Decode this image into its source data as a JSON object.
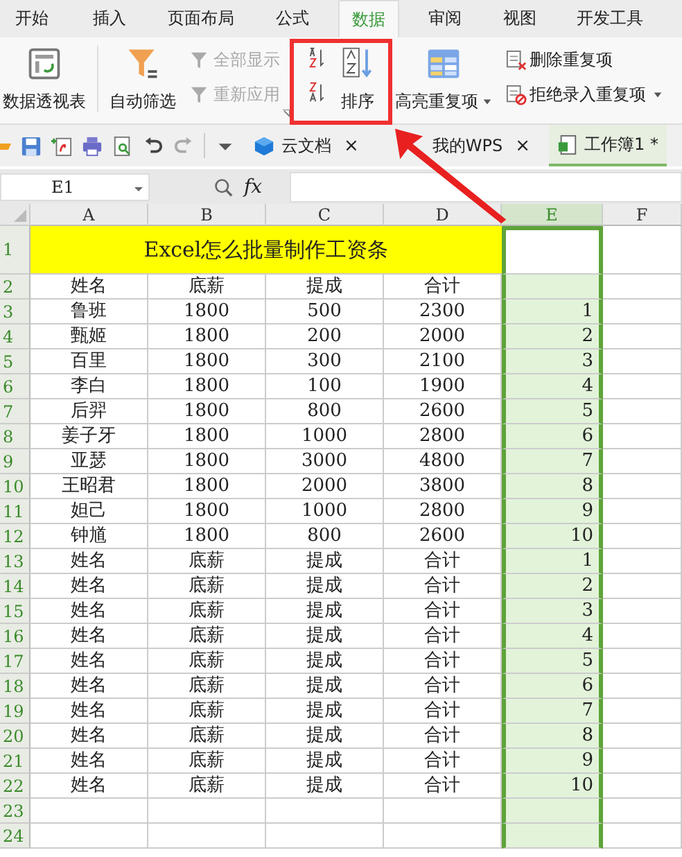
{
  "menu_tabs": [
    {
      "label": "开始",
      "selected": false
    },
    {
      "label": "插入",
      "selected": false
    },
    {
      "label": "页面布局",
      "selected": false
    },
    {
      "label": "公式",
      "selected": false
    },
    {
      "label": "数据",
      "selected": true
    },
    {
      "label": "审阅",
      "selected": false
    },
    {
      "label": "视图",
      "selected": false
    },
    {
      "label": "开发工具",
      "selected": false
    }
  ],
  "ribbon": {
    "pivot_table": {
      "label": "数据透视表"
    },
    "auto_filter": {
      "label": "自动筛选"
    },
    "show_all": {
      "label": "全部显示",
      "disabled": true
    },
    "reapply": {
      "label": "重新应用",
      "disabled": true
    },
    "sort": {
      "label": "排序"
    },
    "highlight_duplicates": {
      "label": "高亮重复项",
      "dropdown": true
    },
    "remove_duplicates": {
      "label": "删除重复项"
    },
    "reject_duplicates": {
      "label": "拒绝录入重复项",
      "dropdown": true
    }
  },
  "doc_tabs": [
    {
      "kind": "cloud",
      "label": "云文档",
      "selected": false
    },
    {
      "kind": "home",
      "label": "我的WPS",
      "selected": false
    },
    {
      "kind": "document",
      "label": "工作簿1 *",
      "selected": true
    }
  ],
  "close_mark": "×",
  "formula_bar": {
    "name_box": "E1",
    "fx": "fx"
  },
  "sheet": {
    "columns": [
      {
        "label": "A",
        "selected": false
      },
      {
        "label": "B",
        "selected": false
      },
      {
        "label": "C",
        "selected": false
      },
      {
        "label": "D",
        "selected": false
      },
      {
        "label": "E",
        "selected": true
      },
      {
        "label": "F",
        "selected": false
      }
    ],
    "title_row": {
      "header": "1",
      "text": "Excel怎么批量制作工资条"
    },
    "rows": [
      {
        "header": "2",
        "cells": [
          "姓名",
          "底薪",
          "提成",
          "合计"
        ]
      },
      {
        "header": "3",
        "cells": [
          "鲁班",
          "1800",
          "500",
          "2300"
        ],
        "e": "1"
      },
      {
        "header": "4",
        "cells": [
          "甄姬",
          "1800",
          "200",
          "2000"
        ],
        "e": "2"
      },
      {
        "header": "5",
        "cells": [
          "百里",
          "1800",
          "300",
          "2100"
        ],
        "e": "3"
      },
      {
        "header": "6",
        "cells": [
          "李白",
          "1800",
          "100",
          "1900"
        ],
        "e": "4"
      },
      {
        "header": "7",
        "cells": [
          "后羿",
          "1800",
          "800",
          "2600"
        ],
        "e": "5"
      },
      {
        "header": "8",
        "cells": [
          "姜子牙",
          "1800",
          "1000",
          "2800"
        ],
        "e": "6"
      },
      {
        "header": "9",
        "cells": [
          "亚瑟",
          "1800",
          "3000",
          "4800"
        ],
        "e": "7"
      },
      {
        "header": "10",
        "cells": [
          "王昭君",
          "1800",
          "2000",
          "3800"
        ],
        "e": "8"
      },
      {
        "header": "11",
        "cells": [
          "妲己",
          "1800",
          "1000",
          "2800"
        ],
        "e": "9"
      },
      {
        "header": "12",
        "cells": [
          "钟馗",
          "1800",
          "800",
          "2600"
        ],
        "e": "10"
      },
      {
        "header": "13",
        "cells": [
          "姓名",
          "底薪",
          "提成",
          "合计"
        ],
        "e": "1"
      },
      {
        "header": "14",
        "cells": [
          "姓名",
          "底薪",
          "提成",
          "合计"
        ],
        "e": "2"
      },
      {
        "header": "15",
        "cells": [
          "姓名",
          "底薪",
          "提成",
          "合计"
        ],
        "e": "3"
      },
      {
        "header": "16",
        "cells": [
          "姓名",
          "底薪",
          "提成",
          "合计"
        ],
        "e": "4"
      },
      {
        "header": "17",
        "cells": [
          "姓名",
          "底薪",
          "提成",
          "合计"
        ],
        "e": "5"
      },
      {
        "header": "18",
        "cells": [
          "姓名",
          "底薪",
          "提成",
          "合计"
        ],
        "e": "6"
      },
      {
        "header": "19",
        "cells": [
          "姓名",
          "底薪",
          "提成",
          "合计"
        ],
        "e": "7"
      },
      {
        "header": "20",
        "cells": [
          "姓名",
          "底薪",
          "提成",
          "合计"
        ],
        "e": "8"
      },
      {
        "header": "21",
        "cells": [
          "姓名",
          "底薪",
          "提成",
          "合计"
        ],
        "e": "9"
      },
      {
        "header": "22",
        "cells": [
          "姓名",
          "底薪",
          "提成",
          "合计"
        ],
        "e": "10"
      },
      {
        "header": "23"
      },
      {
        "header": "24"
      }
    ]
  }
}
